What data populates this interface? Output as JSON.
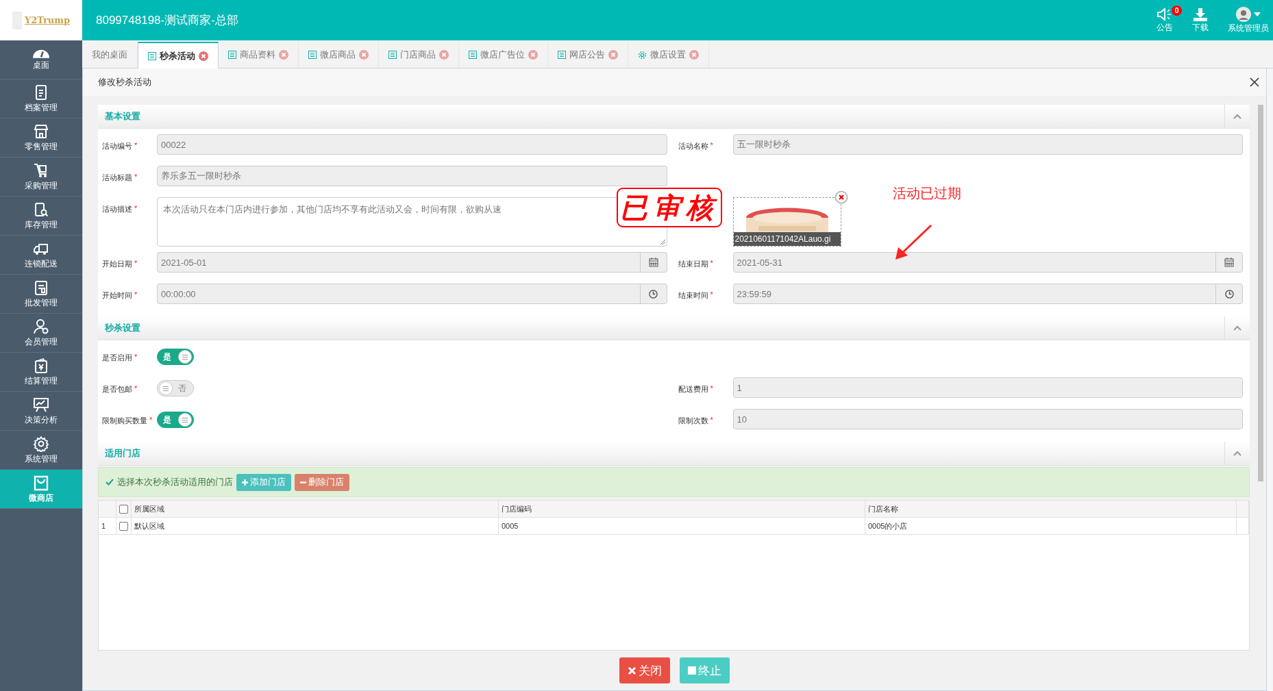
{
  "logo": {
    "text": "Y2Trump"
  },
  "header": {
    "title": "8099748198-测试商家-总部",
    "notice": {
      "label": "公告",
      "badge": "0"
    },
    "download": {
      "label": "下载"
    },
    "user": {
      "label": "系统管理员"
    }
  },
  "sidebar": {
    "items": [
      {
        "label": "桌面",
        "selected": false
      },
      {
        "label": "档案管理",
        "selected": false
      },
      {
        "label": "零售管理",
        "selected": false
      },
      {
        "label": "采购管理",
        "selected": false
      },
      {
        "label": "库存管理",
        "selected": false
      },
      {
        "label": "连锁配送",
        "selected": false
      },
      {
        "label": "批发管理",
        "selected": false
      },
      {
        "label": "会员管理",
        "selected": false
      },
      {
        "label": "结算管理",
        "selected": false
      },
      {
        "label": "决策分析",
        "selected": false
      },
      {
        "label": "系统管理",
        "selected": false
      },
      {
        "label": "微商店",
        "selected": true
      }
    ]
  },
  "tabs": [
    {
      "label": "我的桌面",
      "selected": false,
      "closable": false
    },
    {
      "label": "秒杀活动",
      "selected": true,
      "closable": true
    },
    {
      "label": "商品资料",
      "selected": false,
      "closable": true
    },
    {
      "label": "微店商品",
      "selected": false,
      "closable": true
    },
    {
      "label": "门店商品",
      "selected": false,
      "closable": true
    },
    {
      "label": "微店广告位",
      "selected": false,
      "closable": true
    },
    {
      "label": "网店公告",
      "selected": false,
      "closable": true
    },
    {
      "label": "微店设置",
      "selected": false,
      "closable": true
    }
  ],
  "dialog": {
    "title": "修改秒杀活动",
    "sections": [
      {
        "title": "基本设置",
        "expanded": true,
        "rows": [
          [
            {
              "kind": "text",
              "label": "活动编号",
              "required": "*",
              "value": "00022"
            },
            {
              "kind": "text",
              "label": "活动名称",
              "required": "*",
              "value": "五一限时秒杀"
            }
          ],
          [
            {
              "kind": "text",
              "label": "活动标题",
              "required": "*",
              "value": "养乐多五一限时秒杀"
            }
          ],
          [
            {
              "kind": "textarea",
              "label": "活动描述",
              "required": "*",
              "value": "本次活动只在本门店内进行参加，其他门店均不享有此活动又会，时间有限，欲购从速"
            },
            {
              "filename": "20210601171042ALauo.gi"
            }
          ],
          [
            {
              "kind": "date",
              "label": "开始日期",
              "required": "*",
              "value": "2021-05-01"
            },
            {
              "kind": "date",
              "label": "结束日期",
              "required": "*",
              "value": "2021-05-31"
            }
          ],
          [
            {
              "kind": "time",
              "label": "开始时间",
              "required": "*",
              "value": "00:00:00"
            },
            {
              "kind": "time",
              "label": "结束时间",
              "required": "*",
              "value": "23:59:59"
            }
          ]
        ]
      },
      {
        "title": "秒杀设置",
        "expanded": true,
        "rows": [
          [
            {
              "kind": "toggle",
              "label": "是否启用",
              "required": "*",
              "on": true,
              "text": "是"
            }
          ],
          [
            {
              "kind": "toggle",
              "label": "是否包邮",
              "required": "*",
              "on": false,
              "text": "否"
            },
            {
              "kind": "text",
              "label": "配送费用",
              "required": "*",
              "value": "1"
            }
          ],
          [
            {
              "kind": "toggle",
              "label": "限制购买数量",
              "required": "*",
              "on": true,
              "text": "是"
            },
            {
              "kind": "text",
              "label": "限制次数",
              "required": "*",
              "value": "10"
            }
          ]
        ]
      },
      {
        "title": "适用门店",
        "expanded": true
      }
    ],
    "stamp": {
      "text": "已审核"
    },
    "annotation": {
      "text": "活动已过期"
    },
    "store_hint": "选择本次秒杀活动适用的门店",
    "store_buttons": [
      {
        "kind": "add",
        "label": "添加门店"
      },
      {
        "kind": "delete",
        "label": "删除门店"
      }
    ],
    "table": {
      "header_checked": false,
      "columns": [
        "所属区域",
        "门店编码",
        "门店名称"
      ],
      "rows": [
        {
          "index": "1",
          "checked": false,
          "cells": [
            "默认区域",
            "0005",
            "0005的小店"
          ]
        }
      ]
    },
    "buttons": [
      {
        "kind": "close",
        "label": "关闭"
      },
      {
        "kind": "stop",
        "label": "终止"
      }
    ]
  }
}
